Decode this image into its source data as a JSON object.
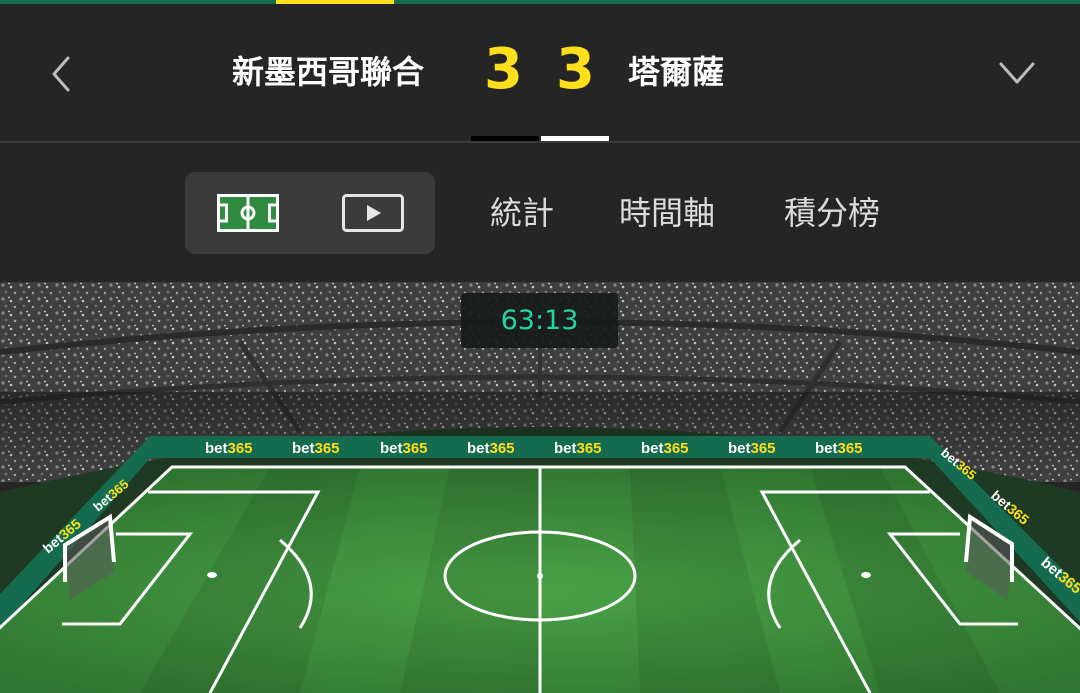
{
  "match": {
    "home_team": "新墨西哥聯合",
    "away_team": "塔爾薩",
    "home_score": "3",
    "away_score": "3",
    "clock": "63:13"
  },
  "tabs": {
    "stats": "統計",
    "timeline": "時間軸",
    "standings": "積分榜"
  },
  "icons": {
    "back": "chevron-left-icon",
    "expand": "chevron-down-icon",
    "pitch": "pitch-view-icon",
    "video": "play-video-icon"
  },
  "ads": {
    "brand_text": "bet365"
  },
  "colors": {
    "brand_green": "#126e51",
    "accent_yellow": "#ffdf1b",
    "clock_green": "#25d4a3",
    "pitch_green": "#3a8a3a"
  }
}
